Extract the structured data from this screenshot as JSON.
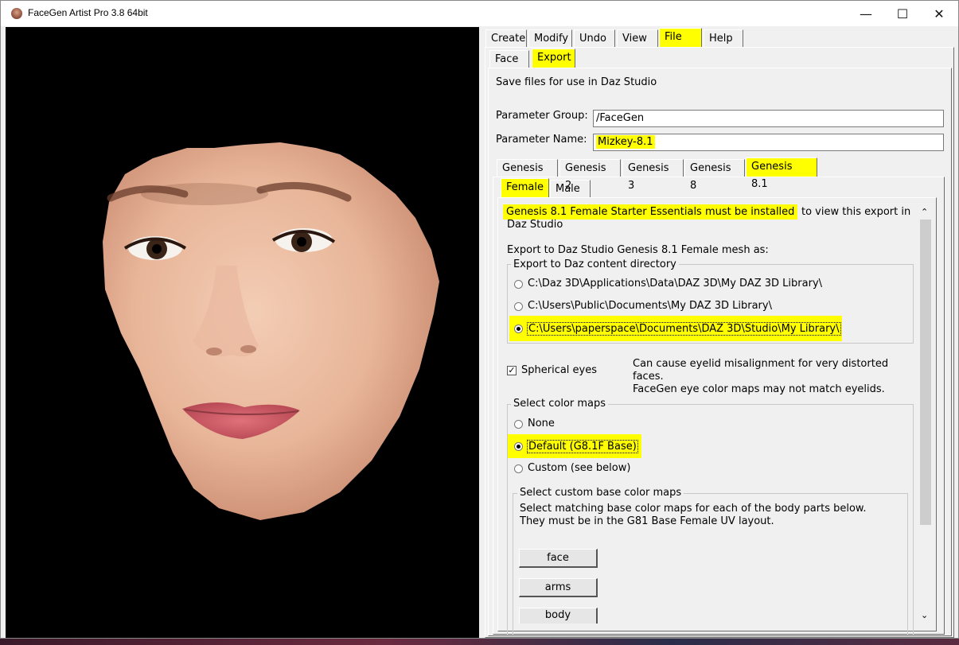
{
  "window": {
    "title": "FaceGen Artist Pro 3.8 64bit"
  },
  "menu_tabs": [
    "Create",
    "Modify",
    "Undo",
    "View",
    "File",
    "Help"
  ],
  "sub_tabs": [
    "Face",
    "Export"
  ],
  "export": {
    "description": "Save files for use in Daz Studio",
    "param_group_label": "Parameter Group:",
    "param_group_value": "/FaceGen",
    "param_name_label": "Parameter Name:",
    "param_name_value": "Mizkey-8.1",
    "genesis_tabs": [
      "Genesis 1",
      "Genesis 2",
      "Genesis 3",
      "Genesis 8",
      "Genesis 8.1"
    ],
    "gender_tabs": [
      "Female",
      "Male"
    ],
    "notice_highlight": "Genesis 8.1 Female Starter Essentials must be installed",
    "notice_rest1": "to view this export in",
    "notice_rest2": "Daz Studio",
    "mesh_heading": "Export to Daz Studio Genesis 8.1 Female mesh as:",
    "content_dir_group": "Export to Daz content directory",
    "content_dirs": [
      "C:\\Daz 3D\\Applications\\Data\\DAZ 3D\\My DAZ 3D Library\\",
      "C:\\Users\\Public\\Documents\\My DAZ 3D Library\\",
      "C:\\Users\\paperspace\\Documents\\DAZ 3D\\Studio\\My Library\\"
    ],
    "spherical_eyes_label": "Spherical eyes",
    "spherical_note1": "Can cause eyelid misalignment for very distorted",
    "spherical_note2": "faces.",
    "spherical_note3": "FaceGen eye color maps may not match eyelids.",
    "color_maps_group": "Select color maps",
    "color_maps": [
      "None",
      "Default (G8.1F Base)",
      "Custom (see below)"
    ],
    "custom_group": "Select custom base color maps",
    "custom_desc1": "Select matching base color maps for each of the body parts below.",
    "custom_desc2": "They must be in the G81 Base Female UV layout.",
    "body_parts": [
      "face",
      "arms",
      "body"
    ]
  },
  "colors": {
    "highlight": "#ffff00",
    "viewport_bg": "#000000",
    "panel_bg": "#f0f0f0"
  }
}
